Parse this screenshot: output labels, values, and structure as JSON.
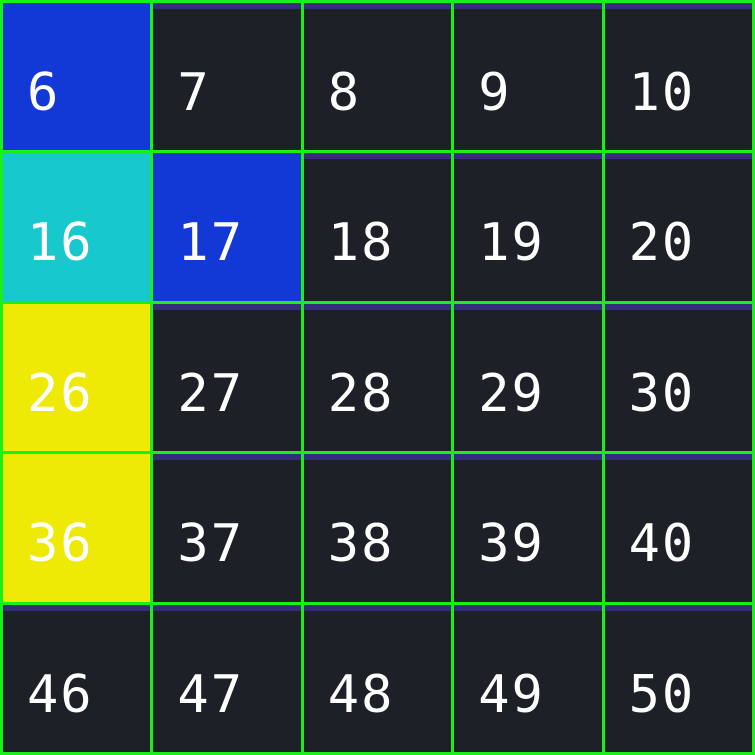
{
  "grid": {
    "rows": [
      [
        {
          "label": "6",
          "state": "blue"
        },
        {
          "label": "7",
          "state": "empty"
        },
        {
          "label": "8",
          "state": "empty"
        },
        {
          "label": "9",
          "state": "empty"
        },
        {
          "label": "10",
          "state": "empty"
        }
      ],
      [
        {
          "label": "16",
          "state": "cyan"
        },
        {
          "label": "17",
          "state": "blue"
        },
        {
          "label": "18",
          "state": "empty"
        },
        {
          "label": "19",
          "state": "empty"
        },
        {
          "label": "20",
          "state": "empty"
        }
      ],
      [
        {
          "label": "26",
          "state": "yellow"
        },
        {
          "label": "27",
          "state": "empty"
        },
        {
          "label": "28",
          "state": "empty"
        },
        {
          "label": "29",
          "state": "empty"
        },
        {
          "label": "30",
          "state": "empty"
        }
      ],
      [
        {
          "label": "36",
          "state": "yellow"
        },
        {
          "label": "37",
          "state": "empty"
        },
        {
          "label": "38",
          "state": "empty"
        },
        {
          "label": "39",
          "state": "empty"
        },
        {
          "label": "40",
          "state": "empty"
        }
      ],
      [
        {
          "label": "46",
          "state": "empty"
        },
        {
          "label": "47",
          "state": "empty"
        },
        {
          "label": "48",
          "state": "empty"
        },
        {
          "label": "49",
          "state": "empty"
        },
        {
          "label": "50",
          "state": "empty"
        }
      ]
    ]
  },
  "colors": {
    "grid_line": "#18f018",
    "empty": "#1d2027",
    "blue": "#1238d6",
    "cyan": "#17c9cc",
    "yellow": "#eeea05",
    "text": "#ffffff"
  }
}
